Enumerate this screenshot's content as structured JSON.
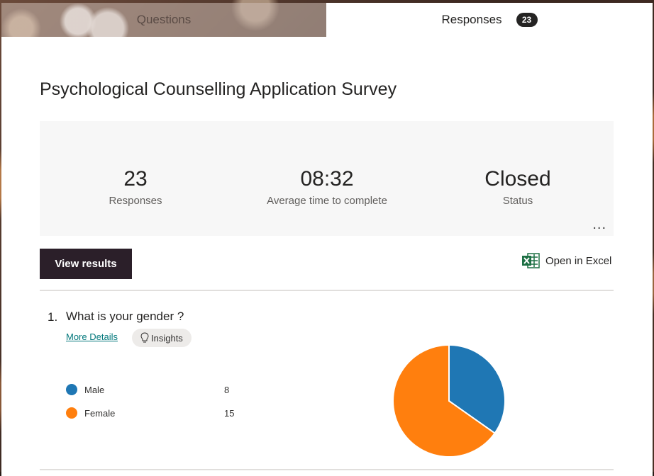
{
  "tabs": {
    "questions": "Questions",
    "responses": "Responses",
    "responses_count": "23"
  },
  "form_title": "Psychological Counselling Application Survey",
  "stats": {
    "responses_value": "23",
    "responses_label": "Responses",
    "avg_time_value": "08:32",
    "avg_time_label": "Average time to complete",
    "status_value": "Closed",
    "status_label": "Status",
    "more_label": "..."
  },
  "actions": {
    "view_results": "View results",
    "open_excel": "Open in Excel"
  },
  "question": {
    "number": "1.",
    "text": "What is your gender ?",
    "more_details": "More Details",
    "insights": "Insights",
    "options": [
      {
        "label": "Male",
        "count": "8",
        "color": "#1f77b4"
      },
      {
        "label": "Female",
        "count": "15",
        "color": "#ff7f0e"
      }
    ]
  },
  "chart_data": {
    "type": "pie",
    "categories": [
      "Male",
      "Female"
    ],
    "values": [
      8,
      15
    ],
    "colors": [
      "#1f77b4",
      "#ff7f0e"
    ]
  },
  "icons": {
    "excel": "excel-icon",
    "insights": "lightbulb-icon",
    "more": "more-options-icon"
  }
}
